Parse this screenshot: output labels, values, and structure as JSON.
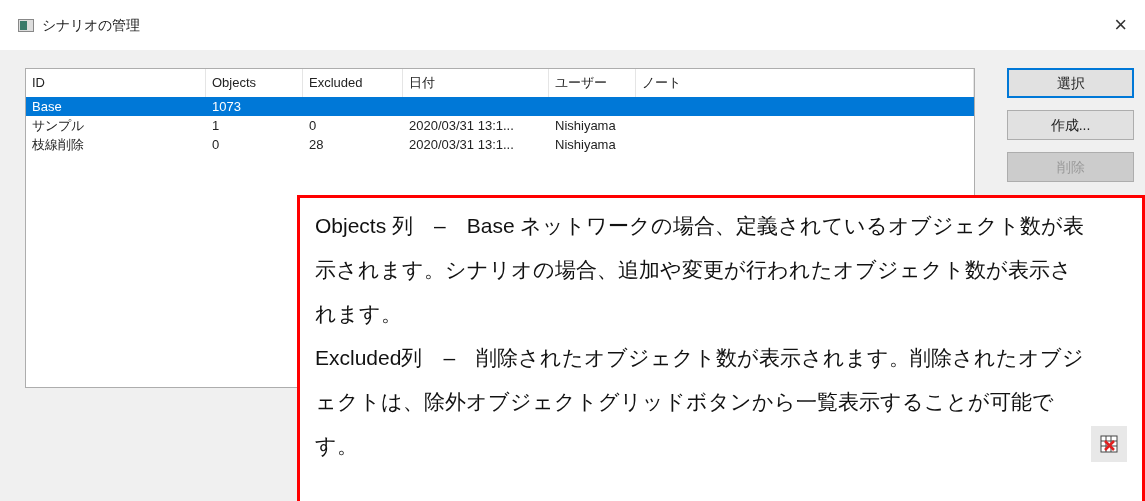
{
  "window": {
    "title": "シナリオの管理",
    "close": "×"
  },
  "table": {
    "columns": [
      "ID",
      "Objects",
      "Excluded",
      "日付",
      "ユーザー",
      "ノート"
    ],
    "rows": [
      {
        "selected": true,
        "cells": [
          "Base",
          "1073",
          "",
          "",
          "",
          ""
        ]
      },
      {
        "selected": false,
        "cells": [
          "サンプル",
          "1",
          "0",
          "2020/03/31 13:1...",
          "Nishiyama",
          ""
        ]
      },
      {
        "selected": false,
        "cells": [
          "枝線削除",
          "0",
          "28",
          "2020/03/31 13:1...",
          "Nishiyama",
          ""
        ]
      }
    ]
  },
  "buttons": [
    {
      "label": "選択",
      "default": true,
      "disabled": false
    },
    {
      "label": "作成...",
      "default": false,
      "disabled": false
    },
    {
      "label": "削除",
      "default": false,
      "disabled": true
    }
  ],
  "callout": {
    "paragraphs": [
      "Objects 列　–　Base ネットワークの場合、定義されているオブジェクト数が表示されます。シナリオの場合、追加や変更が行われたオブジェクト数が表示されます。",
      "Excluded列　–　削除されたオブジェクト数が表示されます。削除されたオブジェクトは、除外オブジェクトグリッドボタンから一覧表示することが可能です。"
    ]
  }
}
